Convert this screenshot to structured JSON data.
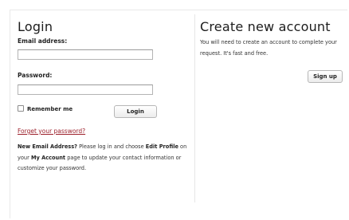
{
  "login": {
    "title": "Login",
    "email_label": "Email address:",
    "email_value": "",
    "password_label": "Password:",
    "password_value": "",
    "remember_label": "Remember me",
    "remember_checked": false,
    "login_button": "Login",
    "forgot_link": "Forget your password?",
    "info": {
      "heading": "New Email Address?",
      "part1": " Please log in and choose ",
      "edit_profile": "Edit Profile",
      "part2": " on your ",
      "my_account": "My Account",
      "part3": " page to update your contact information or customize your password."
    }
  },
  "create": {
    "title": "Create new account",
    "text": "You will need to create an account to complete your request. It's fast and free.",
    "signup_button": "Sign up"
  },
  "colors": {
    "link": "#9c1f2a",
    "text": "#222222",
    "divider": "#e6e6e6"
  }
}
